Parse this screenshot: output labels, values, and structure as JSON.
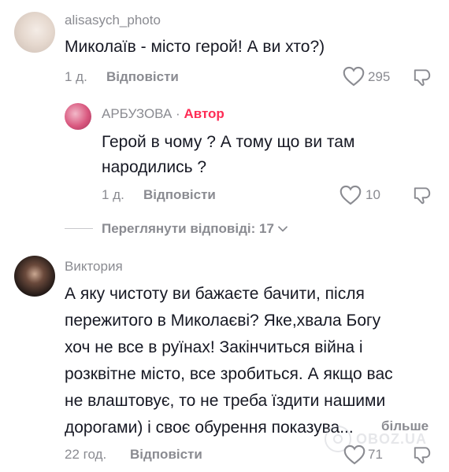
{
  "comment1": {
    "username": "alisasych_photo",
    "text": "Миколаїв - місто герой! А ви хто?)",
    "time": "1 д.",
    "reply_label": "Відповісти",
    "likes": "295"
  },
  "reply1": {
    "username": "АРБУЗОВА",
    "separator": "·",
    "author_label": "Автор",
    "text_line1": "Герой в чому ? А тому що ви там",
    "text_line2": "народились ?",
    "time": "1 д.",
    "reply_label": "Відповісти",
    "likes": "10"
  },
  "view_replies": {
    "label": "Переглянути відповіді: 17"
  },
  "comment2": {
    "username": "Виктория",
    "text_lines": [
      "А яку чистоту ви бажаєте бачити, після",
      "пережитого в Миколаєві? Яке,хвала Богу",
      "хоч не все в руїнах! Закінчиться війна і",
      "розквітне місто, все зробиться. А якщо вас",
      "не влаштовує, то не треба їздити нашими",
      "дорогами) і своє обурення показува..."
    ],
    "more_label": "більше",
    "time": "22 год.",
    "reply_label": "Відповісти",
    "likes": "71"
  },
  "watermark": {
    "text": "OBOZ.UA"
  },
  "colors": {
    "text": "#161823",
    "secondary": "#8a8b91",
    "author_accent": "#fe2c55"
  },
  "icons": [
    "heart-icon",
    "dislike-icon",
    "chevron-down-icon"
  ]
}
